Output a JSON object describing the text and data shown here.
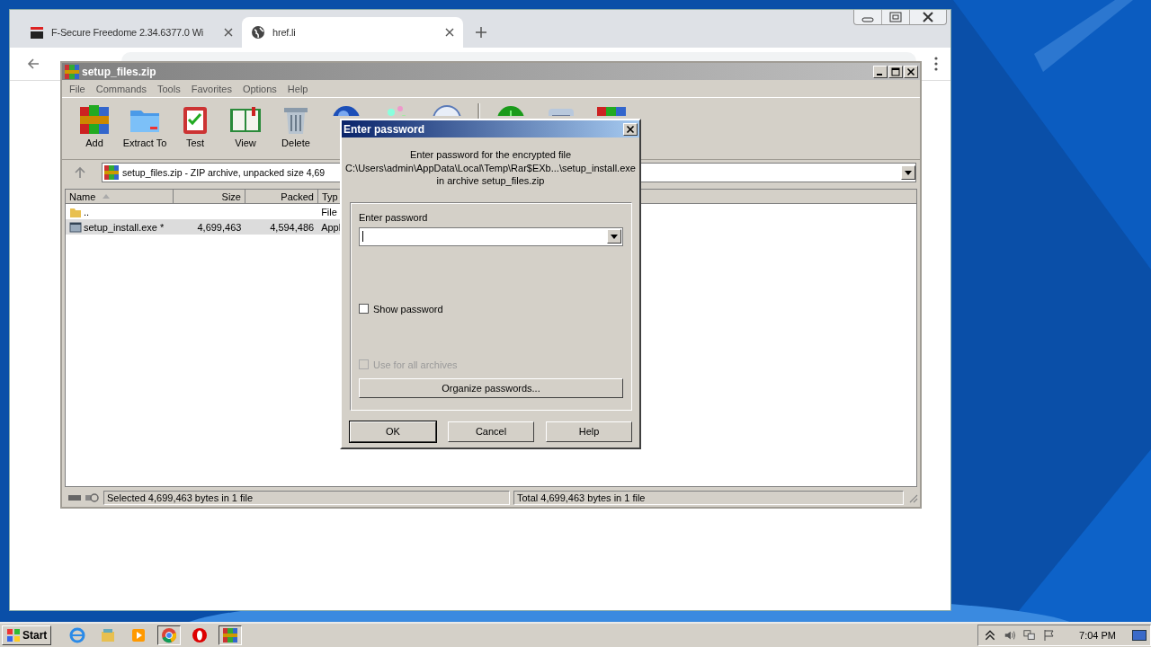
{
  "browser": {
    "tabs": [
      {
        "label": "F-Secure Freedome 2.34.6377.0 Wi",
        "selected": false
      },
      {
        "label": "href.li",
        "selected": true
      }
    ]
  },
  "archiver": {
    "title": "setup_files.zip",
    "menu": [
      "File",
      "Commands",
      "Tools",
      "Favorites",
      "Options",
      "Help"
    ],
    "toolbar": [
      {
        "kind": "add",
        "label": "Add"
      },
      {
        "kind": "extract",
        "label": "Extract To"
      },
      {
        "kind": "test",
        "label": "Test"
      },
      {
        "kind": "view",
        "label": "View"
      },
      {
        "kind": "delete",
        "label": "Delete"
      },
      {
        "kind": "find"
      },
      {
        "kind": "wizard"
      },
      {
        "kind": "info"
      },
      {
        "kind": "separator"
      },
      {
        "kind": "scan"
      },
      {
        "kind": "comment"
      },
      {
        "kind": "sfx"
      }
    ],
    "address": "setup_files.zip - ZIP archive, unpacked size 4,69",
    "columns": [
      "Name",
      "Size",
      "Packed",
      "Typ"
    ],
    "rows": [
      {
        "kind": "folder",
        "selected": false,
        "cells": [
          "..",
          "",
          "",
          "File"
        ]
      },
      {
        "kind": "file",
        "selected": true,
        "cells": [
          "setup_install.exe *",
          "4,699,463",
          "4,594,486",
          "Appl"
        ]
      }
    ],
    "status": [
      "Selected 4,699,463 bytes in 1 file",
      "Total 4,699,463 bytes in 1 file"
    ]
  },
  "dialog": {
    "title": "Enter password",
    "message": [
      "Enter password for the encrypted file",
      "C:\\Users\\admin\\AppData\\Local\\Temp\\Rar$EXb...\\setup_install.exe",
      "in archive setup_files.zip"
    ],
    "field_label": "Enter password",
    "options": [
      {
        "label": "Show password",
        "checked": false,
        "disabled": false
      },
      {
        "label": "Use for all archives",
        "checked": false,
        "disabled": true
      }
    ],
    "organize": "Organize passwords...",
    "buttons": [
      "OK",
      "Cancel",
      "Help"
    ]
  },
  "taskbar": {
    "start": "Start",
    "apps": [
      {
        "kind": "ie"
      },
      {
        "kind": "explorer"
      },
      {
        "kind": "media"
      },
      {
        "kind": "chrome"
      },
      {
        "kind": "opera"
      },
      {
        "kind": "archiver"
      }
    ],
    "clock": "7:04 PM"
  }
}
